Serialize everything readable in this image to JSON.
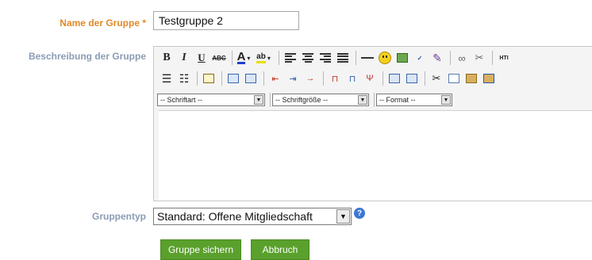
{
  "form": {
    "name_label": "Name der Gruppe *",
    "name_value": "Testgruppe 2",
    "description_label": "Beschreibung der Gruppe",
    "type_label": "Gruppentyp",
    "type_value": "Standard: Offene Mitgliedschaft",
    "help_symbol": "?",
    "save_label": "Gruppe sichern",
    "cancel_label": "Abbruch"
  },
  "editor": {
    "bold": "B",
    "italic": "I",
    "underline": "U",
    "strike": "ABC",
    "font_color": "A",
    "highlight": "ab",
    "font_dropdown": "-- Schriftart --",
    "size_dropdown": "-- Schriftgröße --",
    "format_dropdown": "-- Format --",
    "html_label": "HTI"
  },
  "colors": {
    "required_label": "#e08a2a",
    "label": "#8a9cb4",
    "button": "#5aa02c"
  }
}
